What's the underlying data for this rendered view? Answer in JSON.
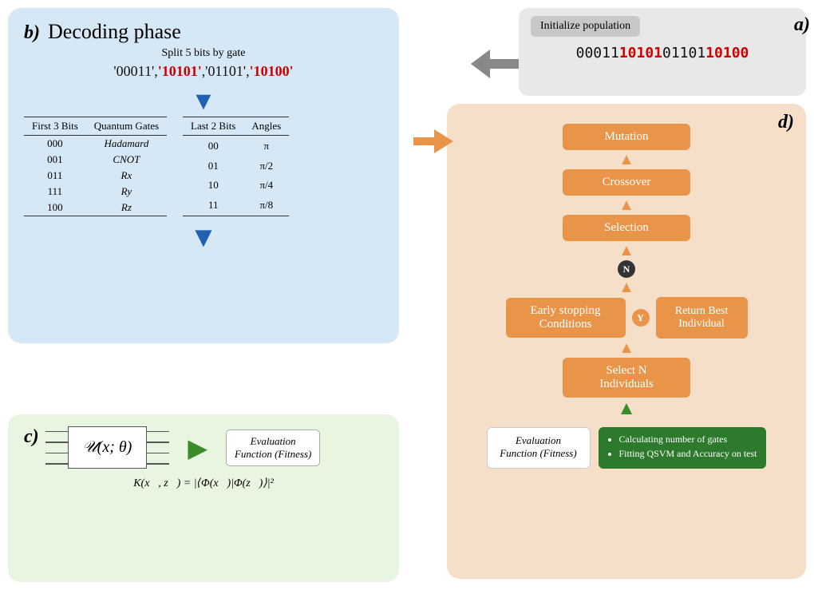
{
  "labels": {
    "a": "a)",
    "b": "b)",
    "c": "c)",
    "d": "d)"
  },
  "section_a": {
    "init_label": "Initialize population",
    "binary_prefix": "00011",
    "binary_red1": "10101",
    "binary_mid": "01101",
    "binary_red2": "10100"
  },
  "section_b": {
    "title": "Decoding phase",
    "split_text": "Split 5 bits by gate",
    "bits_display": "'00011','10101','01101','10100'",
    "table1": {
      "col1": "First 3 Bits",
      "col2": "Quantum Gates",
      "rows": [
        [
          "000",
          "Hadamard"
        ],
        [
          "001",
          "CNOT"
        ],
        [
          "011",
          "Rx"
        ],
        [
          "111",
          "Ry"
        ],
        [
          "100",
          "Rz"
        ]
      ]
    },
    "table2": {
      "col1": "Last 2 Bits",
      "col2": "Angles",
      "rows": [
        [
          "00",
          "π"
        ],
        [
          "01",
          "π/2"
        ],
        [
          "10",
          "π/4"
        ],
        [
          "11",
          "π/8"
        ]
      ]
    }
  },
  "section_c": {
    "circuit_function": "𝒰(x; θ)",
    "eval_label": "Evaluation\nFunction (Fitness)",
    "formula": "K(x⃗, z⃗) = |⟨Φ(x⃗)|Φ(z⃗)⟩|²"
  },
  "section_d": {
    "mutation_label": "Mutation",
    "crossover_label": "Crossover",
    "selection_label": "Selection",
    "n_label": "N",
    "early_stop_label": "Early stopping\nConditions",
    "y_label": "Y",
    "return_best_label": "Return Best Individual",
    "select_n_label": "Select N\nIndividuals",
    "eval_function_label": "Evaluation\nFunction (Fitness)",
    "fitness_items": [
      "Calculating number of gates",
      "Fitting QSVM and Accuracy on test"
    ]
  }
}
